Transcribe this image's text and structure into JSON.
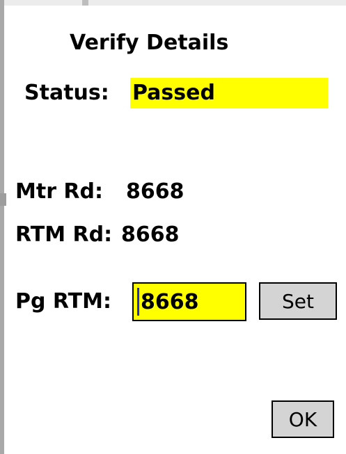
{
  "dialog": {
    "title": "Verify Details"
  },
  "status": {
    "label": "Status:",
    "value": "Passed",
    "highlight_color": "#ffff00"
  },
  "meter_read": {
    "label": "Mtr Rd:",
    "value": "8668"
  },
  "rtm_read": {
    "label": "RTM Rd:",
    "value": "8668"
  },
  "pg_rtm": {
    "label": "Pg RTM:",
    "input_value": "8668",
    "input_background": "#ffff00",
    "set_button_label": "Set"
  },
  "footer": {
    "ok_button_label": "OK"
  }
}
